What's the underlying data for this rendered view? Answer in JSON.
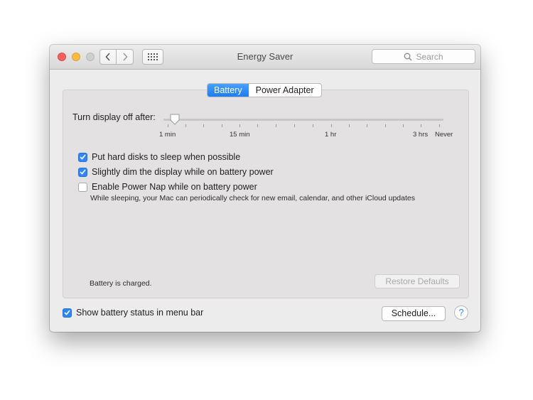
{
  "window": {
    "title": "Energy Saver",
    "search_placeholder": "Search"
  },
  "tabs": [
    {
      "label": "Battery",
      "active": true
    },
    {
      "label": "Power Adapter",
      "active": false
    }
  ],
  "display_sleep": {
    "label": "Turn display off after:",
    "value": "1 min",
    "tick_labels": [
      "1 min",
      "15 min",
      "1 hr",
      "3 hrs",
      "Never"
    ]
  },
  "options": [
    {
      "label": "Put hard disks to sleep when possible",
      "checked": true
    },
    {
      "label": "Slightly dim the display while on battery power",
      "checked": true
    },
    {
      "label": "Enable Power Nap while on battery power",
      "checked": false
    }
  ],
  "power_nap_note": "While sleeping, your Mac can periodically check for new email, calendar, and other iCloud updates",
  "battery_status": "Battery is charged.",
  "buttons": {
    "restore_defaults": "Restore Defaults",
    "schedule": "Schedule...",
    "help": "?"
  },
  "menu_bar_option": {
    "label": "Show battery status in menu bar",
    "checked": true
  },
  "colors": {
    "accent": "#2f86f6",
    "close": "#fc615d",
    "minimize": "#fdbc40"
  }
}
